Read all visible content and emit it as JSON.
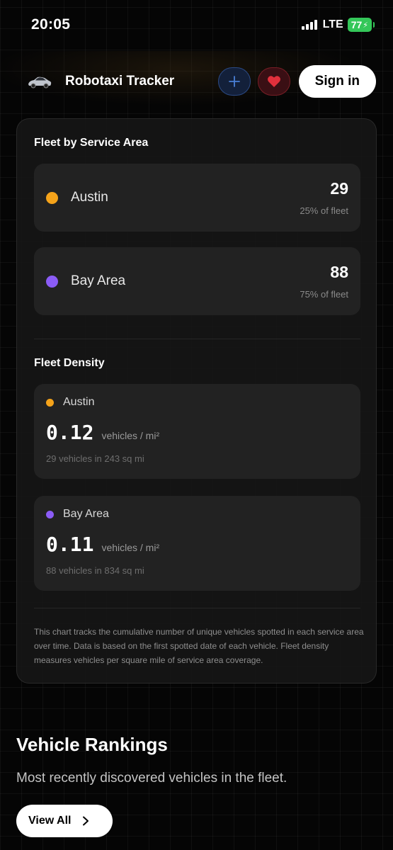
{
  "status_bar": {
    "time": "20:05",
    "network": "LTE",
    "battery": "77"
  },
  "header": {
    "title": "Robotaxi Tracker",
    "signin_label": "Sign in",
    "icons": {
      "logo": "car-icon",
      "add": "plus-icon",
      "favorite": "heart-icon"
    },
    "colors": {
      "add_accent": "#4a7fd6",
      "heart": "#e0303c"
    }
  },
  "fleet_by_area": {
    "title": "Fleet by Service Area",
    "areas": [
      {
        "name": "Austin",
        "count": "29",
        "pct": "25% of fleet",
        "color": "#f5a31a"
      },
      {
        "name": "Bay Area",
        "count": "88",
        "pct": "75% of fleet",
        "color": "#8b5cf6"
      }
    ]
  },
  "fleet_density": {
    "title": "Fleet Density",
    "areas": [
      {
        "name": "Austin",
        "value": "0.12",
        "unit": "vehicles / mi²",
        "detail": "29 vehicles in 243 sq mi",
        "color": "#f5a31a"
      },
      {
        "name": "Bay Area",
        "value": "0.11",
        "unit": "vehicles / mi²",
        "detail": "88 vehicles in 834 sq mi",
        "color": "#8b5cf6"
      }
    ]
  },
  "footnote": "This chart tracks the cumulative number of unique vehicles spotted in each service area over time. Data is based on the first spotted date of each vehicle. Fleet density measures vehicles per square mile of service area coverage.",
  "rankings": {
    "title": "Vehicle Rankings",
    "subtitle": "Most recently discovered vehicles in the fleet.",
    "view_all_label": "View All"
  }
}
